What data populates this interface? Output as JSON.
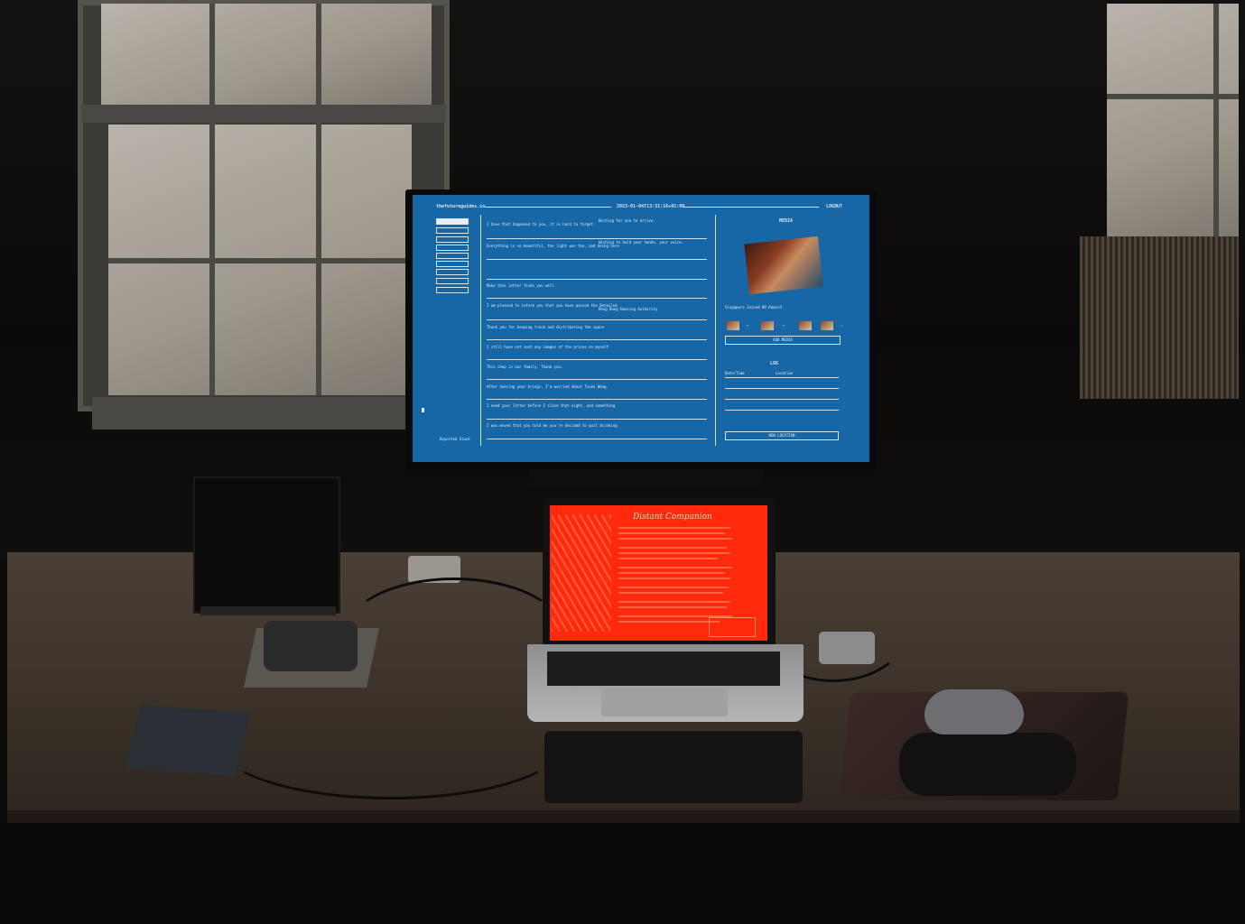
{
  "monitor": {
    "title": "thefutureguides.io",
    "timestamp": "2023-01-04T13:31:16+01:00",
    "logout": "LOGOUT",
    "sidebar_footer": "Reported Stuck",
    "sidebar_items": [
      "",
      "",
      "",
      "",
      "",
      "",
      "",
      "",
      ""
    ],
    "messages": [
      {
        "text": "I have that happened to you, it is hard to forget.",
        "meta": "Waiting for you to arrive."
      },
      {
        "text": "Everything is so beautiful, the light was too, and being here",
        "meta": "Wishing to hold your hands, your voice."
      },
      {
        "text": "",
        "meta": ""
      },
      {
        "text": "Make this letter finds you well.",
        "meta": ""
      },
      {
        "text": "I am pleased to inform you that you have passed the Detailed",
        "meta": "Hong Kong Housing Authority"
      },
      {
        "text": "Thank you for keeping track and distributing the space",
        "meta": ""
      },
      {
        "text": "I still have not sent any images of the prices on myself",
        "meta": ""
      },
      {
        "text": "This shop is our family. Thank you.",
        "meta": ""
      },
      {
        "text": "After hearing your brings, I'm worried about Tsuen Wang.",
        "meta": ""
      },
      {
        "text": "I need your letter before I close that night, and something",
        "meta": ""
      },
      {
        "text": "I was moved that you told me you're decided to quit drinking",
        "meta": ""
      }
    ],
    "right_panel": {
      "media_heading": "MEDIA",
      "caption": "Singapore Joined 09 Aboard",
      "add_media": "ADD MEDIA",
      "log_heading": "LOG",
      "log_columns": [
        "Date/Time",
        "Location"
      ],
      "new_location": "NEW LOCATION"
    }
  },
  "laptop": {
    "title": "Distant Companion"
  }
}
